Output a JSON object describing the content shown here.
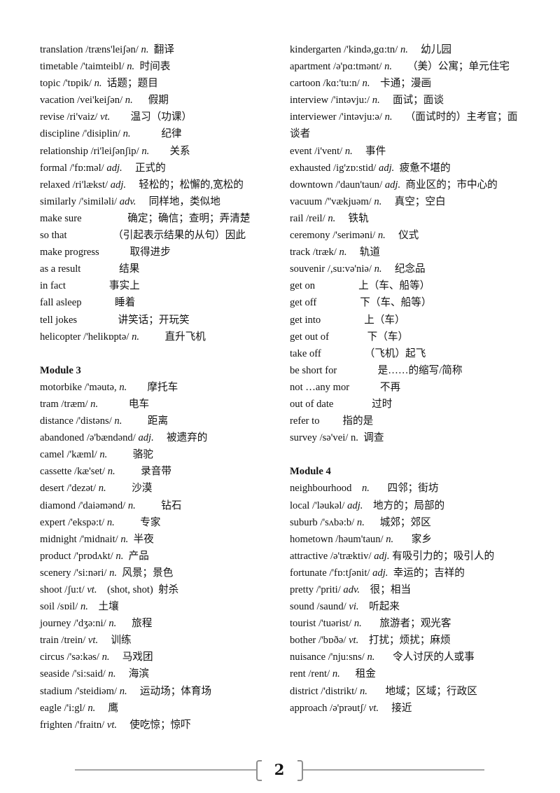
{
  "left_column": [
    {
      "type": "entry",
      "word": "translation",
      "phonetic": "/træns'leiʃən/",
      "pos": "n.",
      "gap": "  ",
      "meaning": "翻译"
    },
    {
      "type": "entry",
      "word": "timetable",
      "phonetic": "/'taimteibl/",
      "pos": "n.",
      "gap": "  ",
      "meaning": "时间表"
    },
    {
      "type": "entry",
      "word": "topic",
      "phonetic": "/'tɒpik/",
      "pos": "n.",
      "gap": "  ",
      "meaning": "话题；题目"
    },
    {
      "type": "entry",
      "word": "vacation",
      "phonetic": "/vei'keiʃən/",
      "pos": "n.",
      "gap": "      ",
      "meaning": "假期"
    },
    {
      "type": "entry",
      "word": "revise",
      "phonetic": "/ri'vaiz/",
      "pos": "vt.",
      "gap": "        ",
      "meaning": "温习（功课）"
    },
    {
      "type": "entry",
      "word": "discipline",
      "phonetic": "/'disiplin/",
      "pos": "n.",
      "gap": "            ",
      "meaning": "纪律"
    },
    {
      "type": "entry",
      "word": "relationship",
      "phonetic": "/ri'leiʃənʃip/",
      "pos": "n.",
      "gap": "        ",
      "meaning": "关系"
    },
    {
      "type": "entry",
      "word": "formal",
      "phonetic": "/'fɒ:məl/",
      "pos": "adj.",
      "gap": "     ",
      "meaning": "正式的"
    },
    {
      "type": "entry",
      "word": "relaxed",
      "phonetic": "/ri'lækst/",
      "pos": "adj.",
      "gap": "     ",
      "meaning": "轻松的；松懈的,宽松的"
    },
    {
      "type": "entry",
      "word": "similarly",
      "phonetic": "/'similəli/",
      "pos": "adv.",
      "gap": "     ",
      "meaning": "同样地，类似地"
    },
    {
      "type": "phrase",
      "word": "make sure",
      "gap": "                  ",
      "meaning": "确定；确信；查明；弄清楚"
    },
    {
      "type": "phrase",
      "word": "so that",
      "gap": "                  ",
      "meaning": "（引起表示结果的从句）因此"
    },
    {
      "type": "phrase",
      "word": "make progress",
      "gap": "            ",
      "meaning": "取得进步"
    },
    {
      "type": "phrase",
      "word": "as a result",
      "gap": "               ",
      "meaning": "结果"
    },
    {
      "type": "phrase",
      "word": "in fact",
      "gap": "                 ",
      "meaning": "事实上"
    },
    {
      "type": "phrase",
      "word": "fall asleep",
      "gap": "             ",
      "meaning": "睡着"
    },
    {
      "type": "phrase",
      "word": "tell jokes",
      "gap": "                ",
      "meaning": "讲笑话；开玩笑"
    },
    {
      "type": "entry",
      "word": "helicopter",
      "phonetic": "/'helikɒptə/",
      "pos": "n.",
      "gap": "          ",
      "meaning": "直升飞机"
    },
    {
      "type": "blank"
    },
    {
      "type": "heading",
      "text": "Module 3"
    },
    {
      "type": "entry",
      "word": "motorbike",
      "phonetic": "/'məutə,",
      "pos": "n.",
      "gap": "        ",
      "meaning": "摩托车"
    },
    {
      "type": "entry",
      "word": "tram",
      "phonetic": "/træm/",
      "pos": "n.",
      "gap": "            ",
      "meaning": "电车"
    },
    {
      "type": "entry",
      "word": "distance",
      "phonetic": "/'distəns/",
      "pos": "n.",
      "gap": "          ",
      "meaning": "距离"
    },
    {
      "type": "entry",
      "word": "abandoned",
      "phonetic": "/ə'bændənd/",
      "pos": "adj.",
      "gap": "     ",
      "meaning": "被遗弃的"
    },
    {
      "type": "entry",
      "word": "camel",
      "phonetic": "/'kæml/",
      "pos": "n.",
      "gap": "          ",
      "meaning": "骆驼"
    },
    {
      "type": "entry",
      "word": "cassette",
      "phonetic": "/kæ'set/",
      "pos": "n.",
      "gap": "          ",
      "meaning": "录音带"
    },
    {
      "type": "entry",
      "word": "desert",
      "phonetic": "/'dezət/",
      "pos": "n.",
      "gap": "          ",
      "meaning": "沙漠"
    },
    {
      "type": "entry",
      "word": "diamond",
      "phonetic": "/'daiəmənd/",
      "pos": "n.",
      "gap": "          ",
      "meaning": "钻石"
    },
    {
      "type": "entry",
      "word": "expert",
      "phonetic": "/'ekspə:t/",
      "pos": "n.",
      "gap": "          ",
      "meaning": "专家"
    },
    {
      "type": "entry",
      "word": "midnight",
      "phonetic": "/'midnait/",
      "pos": "n.",
      "gap": "  ",
      "meaning": "半夜"
    },
    {
      "type": "entry",
      "word": "product",
      "phonetic": "/'prɒdʌkt/",
      "pos": "n.",
      "gap": "  ",
      "meaning": "产品"
    },
    {
      "type": "entry",
      "word": "scenery",
      "phonetic": "/'si:nəri/",
      "pos": "n.",
      "gap": "  ",
      "meaning": "风景；景色"
    },
    {
      "type": "entry",
      "word": "shoot",
      "phonetic": "/ʃu:t/",
      "pos": "vt.",
      "gap": "    ",
      "meaning": "(shot, shot)  射杀"
    },
    {
      "type": "entry",
      "word": "soil",
      "phonetic": "/sɒil/",
      "pos": "n.",
      "gap": "    ",
      "meaning": "土壤"
    },
    {
      "type": "entry",
      "word": "journey",
      "phonetic": "/'dʒə:ni/",
      "pos": "n.",
      "gap": "      ",
      "meaning": "旅程"
    },
    {
      "type": "entry",
      "word": "train",
      "phonetic": "/trein/",
      "pos": "vt.",
      "gap": "     ",
      "meaning": "训练"
    },
    {
      "type": "entry",
      "word": "circus",
      "phonetic": "/'sə:kəs/",
      "pos": "n.",
      "gap": "     ",
      "meaning": "马戏团"
    },
    {
      "type": "entry",
      "word": "seaside",
      "phonetic": "/'si:said/",
      "pos": "n.",
      "gap": "     ",
      "meaning": "海滨"
    },
    {
      "type": "entry",
      "word": "stadium",
      "phonetic": "/'steidiəm/",
      "pos": "n.",
      "gap": "     ",
      "meaning": "运动场；体育场"
    },
    {
      "type": "entry",
      "word": "eagle",
      "phonetic": "/'i:gl/",
      "pos": "n.",
      "gap": "     ",
      "meaning": "鹰"
    },
    {
      "type": "entry",
      "word": "frighten",
      "phonetic": "/'fraitn/",
      "pos": "vt.",
      "gap": "     ",
      "meaning": "使吃惊；惊吓"
    }
  ],
  "right_column": [
    {
      "type": "entry",
      "word": "kindergarten",
      "phonetic": "/'kində,gɑ:tn/",
      "pos": "n.",
      "gap": "     ",
      "meaning": "幼儿园"
    },
    {
      "type": "entry",
      "word": "apartment",
      "phonetic": "/ə'pɑ:tmənt/",
      "pos": "n.",
      "gap": "      ",
      "meaning": "（美）公寓；单元住宅",
      "wrap": true
    },
    {
      "type": "entry",
      "word": "cartoon",
      "phonetic": "/kɑ:'tu:n/",
      "pos": "n.",
      "gap": "    ",
      "meaning": "卡通；漫画"
    },
    {
      "type": "entry",
      "word": "interview",
      "phonetic": "/'intəvju:/",
      "pos": "n.",
      "gap": "     ",
      "meaning": "面试；面谈"
    },
    {
      "type": "entry",
      "word": "interviewer",
      "phonetic": "/'intəvju:ə/",
      "pos": "n.",
      "gap": "     ",
      "meaning": "（面试时的）主考官；面谈者",
      "wrap": true
    },
    {
      "type": "entry",
      "word": "event",
      "phonetic": "/i'vent/",
      "pos": "n.",
      "gap": "     ",
      "meaning": "事件"
    },
    {
      "type": "entry",
      "word": "exhausted",
      "phonetic": "/ig'zɒ:stid/",
      "pos": "adj.",
      "gap": "  ",
      "meaning": "疲惫不堪的"
    },
    {
      "type": "entry",
      "word": "downtown",
      "phonetic": "/'daun'taun/",
      "pos": "adj.",
      "gap": "  ",
      "meaning": "商业区的；市中心的"
    },
    {
      "type": "entry",
      "word": "vacuum",
      "phonetic": "/''vækjuəm/",
      "pos": "n.",
      "gap": "     ",
      "meaning": "真空；空白"
    },
    {
      "type": "entry",
      "word": "rail",
      "phonetic": "/reil/",
      "pos": "n.",
      "gap": "     ",
      "meaning": "铁轨"
    },
    {
      "type": "entry",
      "word": "ceremony",
      "phonetic": "/'seriməni/",
      "pos": "n.",
      "gap": "     ",
      "meaning": "仪式"
    },
    {
      "type": "entry",
      "word": "track",
      "phonetic": "/træk/",
      "pos": "n.",
      "gap": "     ",
      "meaning": "轨道"
    },
    {
      "type": "entry",
      "word": "souvenir",
      "phonetic": "/,su:və'niə/",
      "pos": "n.",
      "gap": "     ",
      "meaning": "纪念品"
    },
    {
      "type": "phrase",
      "word": "get on",
      "gap": "                 ",
      "meaning": "上（车、船等）"
    },
    {
      "type": "phrase",
      "word": "get off",
      "gap": "                 ",
      "meaning": "下（车、船等）"
    },
    {
      "type": "phrase",
      "word": "get into",
      "gap": "                 ",
      "meaning": "上（车）"
    },
    {
      "type": "phrase",
      "word": "get out of",
      "gap": "               ",
      "meaning": "下（车）"
    },
    {
      "type": "phrase",
      "word": "take off",
      "gap": "                 ",
      "meaning": "（飞机）起飞"
    },
    {
      "type": "phrase",
      "word": "be short for",
      "gap": "                ",
      "meaning": "是……的缩写/简称"
    },
    {
      "type": "phrase",
      "word": "not …any mor",
      "gap": "            ",
      "meaning": "不再"
    },
    {
      "type": "phrase",
      "word": "out of date",
      "gap": "               ",
      "meaning": "过时"
    },
    {
      "type": "phrase",
      "word": "refer to",
      "gap": "         ",
      "meaning": "指的是"
    },
    {
      "type": "entry",
      "word": "survey",
      "phonetic": "/sə'vei/",
      "pos": "n.",
      "plain_pos": true,
      "gap": "  ",
      "meaning": "调查"
    },
    {
      "type": "blank"
    },
    {
      "type": "heading",
      "text": "Module 4"
    },
    {
      "type": "entry",
      "word": "neighbourhood",
      "phonetic": "  ",
      "pos": "n.",
      "gap": "       ",
      "meaning": "四邻；街坊"
    },
    {
      "type": "entry",
      "word": "local",
      "phonetic": "/'ləukəl/",
      "pos": "adj.",
      "gap": "    ",
      "meaning": "地方的；局部的"
    },
    {
      "type": "entry",
      "word": "suburb",
      "phonetic": "/'sʌbə:b/",
      "pos": "n.",
      "gap": "      ",
      "meaning": "城郊；郊区"
    },
    {
      "type": "entry",
      "word": "hometown",
      "phonetic": "/həum'taun/",
      "pos": "n.",
      "gap": "       ",
      "meaning": "家乡"
    },
    {
      "type": "entry",
      "word": "attractive",
      "phonetic": "/ə'træktiv/",
      "pos": "adj.",
      "gap": " ",
      "meaning": "有吸引力的；吸引人的"
    },
    {
      "type": "entry",
      "word": "fortunate",
      "phonetic": "/'fɒ:tʃənit/",
      "pos": "adj.",
      "gap": "  ",
      "meaning": "幸运的；吉祥的"
    },
    {
      "type": "entry",
      "word": "pretty",
      "phonetic": "/'priti/",
      "pos": "adv.",
      "gap": "    ",
      "meaning": "很；相当"
    },
    {
      "type": "entry",
      "word": "sound",
      "phonetic": "/saund/",
      "pos": "vi.",
      "gap": "    ",
      "meaning": "听起来"
    },
    {
      "type": "entry",
      "word": "tourist",
      "phonetic": "/'tuərist/",
      "pos": "n.",
      "gap": "       ",
      "meaning": "旅游者；观光客"
    },
    {
      "type": "entry",
      "word": "bother",
      "phonetic": "/'bɒðə/",
      "pos": "vt.",
      "gap": "    ",
      "meaning": "打扰；烦扰；麻烦"
    },
    {
      "type": "entry",
      "word": "nuisance",
      "phonetic": "/'nju:sns/",
      "pos": "n.",
      "gap": "       ",
      "meaning": "令人讨厌的人或事"
    },
    {
      "type": "entry",
      "word": "rent",
      "phonetic": "/rent/",
      "pos": "n.",
      "gap": "      ",
      "meaning": "租金"
    },
    {
      "type": "entry",
      "word": "district",
      "phonetic": "/'distrikt/",
      "pos": "n.",
      "gap": "       ",
      "meaning": "地域；区域；行政区"
    },
    {
      "type": "entry",
      "word": "approach",
      "phonetic": "/ə'prəutʃ/",
      "pos": "vt.",
      "gap": "     ",
      "meaning": "接近"
    }
  ],
  "footer": {
    "page_number": "2"
  }
}
